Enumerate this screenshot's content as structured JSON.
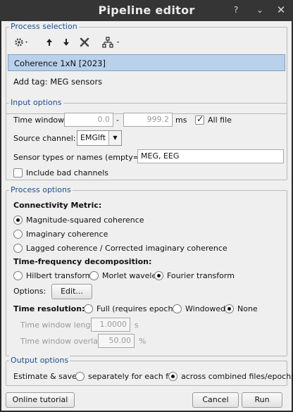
{
  "window": {
    "title": "Pipeline editor",
    "buttons": {
      "help": "?",
      "minimize": "⌄",
      "close": "✕"
    }
  },
  "process_selection": {
    "legend": "Process selection",
    "toolbar": {
      "settings_icon": "gear-icon",
      "up_icon": "arrow-up-icon",
      "down_icon": "arrow-down-icon",
      "delete_icon": "delete-x-icon",
      "pipeline_icon": "pipeline-tree-icon"
    },
    "items": [
      {
        "label": "Coherence 1xN [2023]",
        "selected": true
      },
      {
        "label": "Add tag: MEG sensors",
        "selected": false
      }
    ]
  },
  "input_options": {
    "legend": "Input options",
    "time_window_label": "Time window:",
    "time_start": "0.0",
    "time_separator": "-",
    "time_end": "999.2",
    "time_unit": "ms",
    "all_file_label": "All file",
    "all_file_checked": true,
    "source_channel_label": "Source channel:",
    "source_channel_value": "EMGlft",
    "sensor_label": "Sensor types or names (empty=all):",
    "sensor_value": "MEG, EEG",
    "include_bad_label": "Include bad channels",
    "include_bad_checked": false
  },
  "process_options": {
    "legend": "Process options",
    "connectivity_title": "Connectivity Metric:",
    "metrics": [
      {
        "label": "Magnitude-squared coherence",
        "selected": true
      },
      {
        "label": "Imaginary coherence",
        "selected": false
      },
      {
        "label": "Lagged coherence / Corrected imaginary coherence",
        "selected": false
      }
    ],
    "tf_title": "Time-frequency decomposition:",
    "tf_methods": [
      {
        "label": "Hilbert transform",
        "selected": false
      },
      {
        "label": "Morlet wavelets",
        "selected": false
      },
      {
        "label": "Fourier transform",
        "selected": true
      }
    ],
    "options_label": "Options:",
    "edit_button": "Edit...",
    "time_resolution_title": "Time resolution:",
    "time_resolution": [
      {
        "label": "Full (requires epochs)",
        "selected": false
      },
      {
        "label": "Windowed",
        "selected": false
      },
      {
        "label": "None",
        "selected": true
      }
    ],
    "tw_length_label": "Time window length:",
    "tw_length_value": "1.0000",
    "tw_length_unit": "s",
    "tw_overlap_label": "Time window overlap:",
    "tw_overlap_value": "50.00",
    "tw_overlap_unit": "%"
  },
  "output_options": {
    "legend": "Output options",
    "estimate_label": "Estimate & save:",
    "choices": [
      {
        "label": "separately for each file",
        "selected": false
      },
      {
        "label": "across combined files/epochs",
        "selected": true
      }
    ]
  },
  "footer": {
    "tutorial_button": "Online tutorial",
    "cancel_button": "Cancel",
    "run_button": "Run"
  }
}
